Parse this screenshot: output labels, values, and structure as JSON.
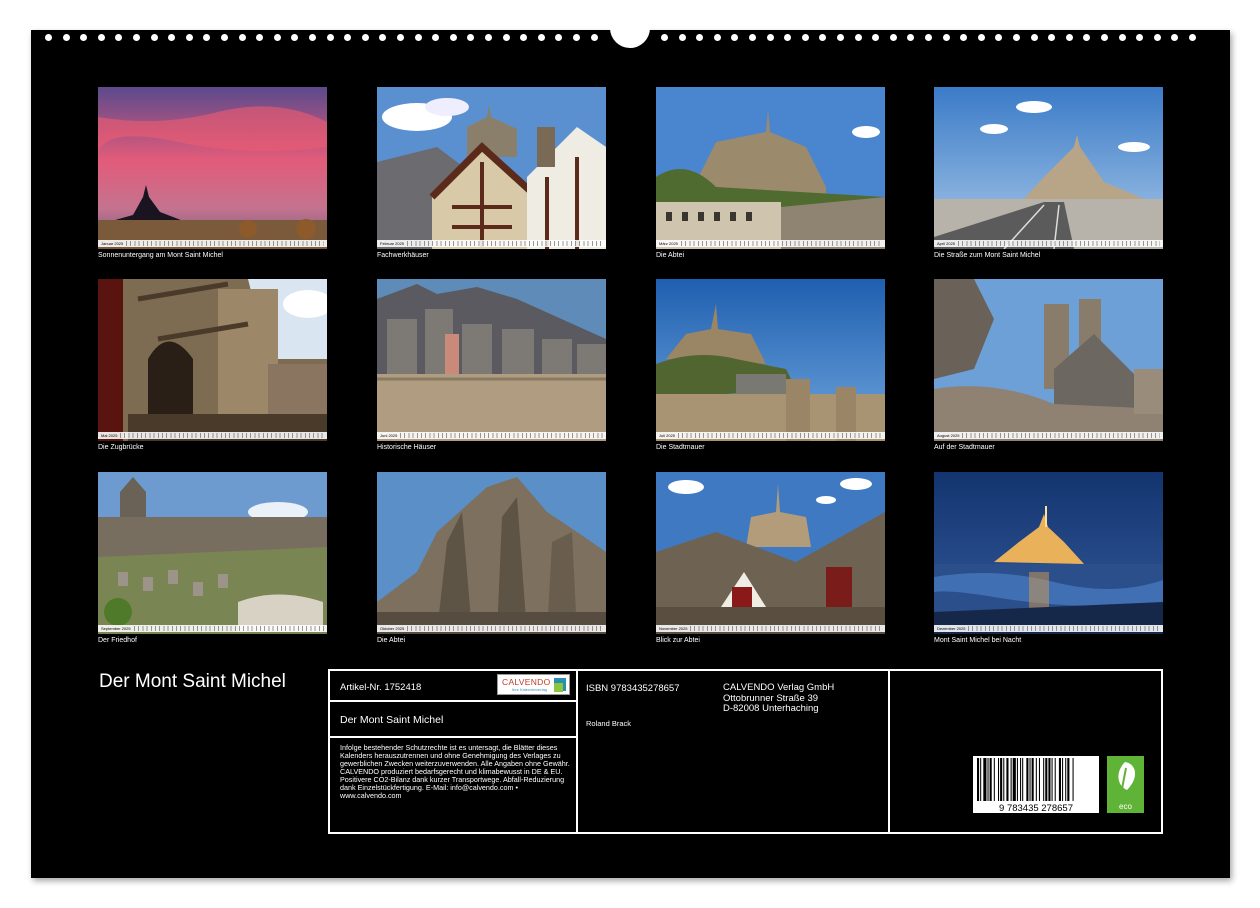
{
  "calendar": {
    "title": "Der Mont Saint Michel",
    "months": [
      {
        "label": "Januar 2025",
        "caption": "Sonnenuntergang am Mont Saint Michel",
        "scene": "sunset"
      },
      {
        "label": "Februar 2025",
        "caption": "Fachwerkhäuser",
        "scene": "timber"
      },
      {
        "label": "März 2025",
        "caption": "Die Abtei",
        "scene": "abbey-day"
      },
      {
        "label": "April 2025",
        "caption": "Die Straße zum Mont Saint Michel",
        "scene": "road"
      },
      {
        "label": "Mai 2025",
        "caption": "Die Zugbrücke",
        "scene": "drawbridge"
      },
      {
        "label": "Juni 2025",
        "caption": "Historische Häuser",
        "scene": "houses"
      },
      {
        "label": "Juli 2025",
        "caption": "Die Stadtmauer",
        "scene": "wall"
      },
      {
        "label": "August 2025",
        "caption": "Auf der Stadtmauer",
        "scene": "onwall"
      },
      {
        "label": "September 2025",
        "caption": "Der Friedhof",
        "scene": "cemetery"
      },
      {
        "label": "Oktober 2025",
        "caption": "Die Abtei",
        "scene": "abbey-low"
      },
      {
        "label": "November 2025",
        "caption": "Blick zur Abtei",
        "scene": "roofs"
      },
      {
        "label": "Dezember 2025",
        "caption": "Mont Saint Michel bei Nacht",
        "scene": "night"
      }
    ]
  },
  "imprint": {
    "article_label": "Artikel-Nr. 1752418",
    "logo_brand": "CALVENDO",
    "logo_tagline": "Ihre Kalenderverlag",
    "book_title": "Der Mont Saint Michel",
    "notice": "Infolge bestehender Schutzrechte ist es untersagt, die Blätter dieses Kalenders herauszutrennen und ohne Genehmigung des Verlages zu gewerblichen Zwecken weiterzuverwenden. Alle Angaben ohne Gewähr. CALVENDO produziert bedarfsgerecht und klimabewusst in DE & EU. Positivere CO2-Bilanz dank kurzer Transportwege. Abfall-Reduzierung dank Einzelstückfertigung. E-Mail: info@calvendo.com • www.calvendo.com",
    "isbn": "ISBN 9783435278657",
    "author": "Roland Brack",
    "publisher_line1": "CALVENDO Verlag GmbH",
    "publisher_line2": "Ottobrunner Straße 39",
    "publisher_line3": "D-82008 Unterhaching",
    "barcode_digits": "9 783435 278657",
    "eco_label": "eco"
  },
  "colors": {
    "sheet": "#000000",
    "text": "#ffffff",
    "eco_green": "#5fb336",
    "calvendo_blue": "#2c8fb0"
  }
}
